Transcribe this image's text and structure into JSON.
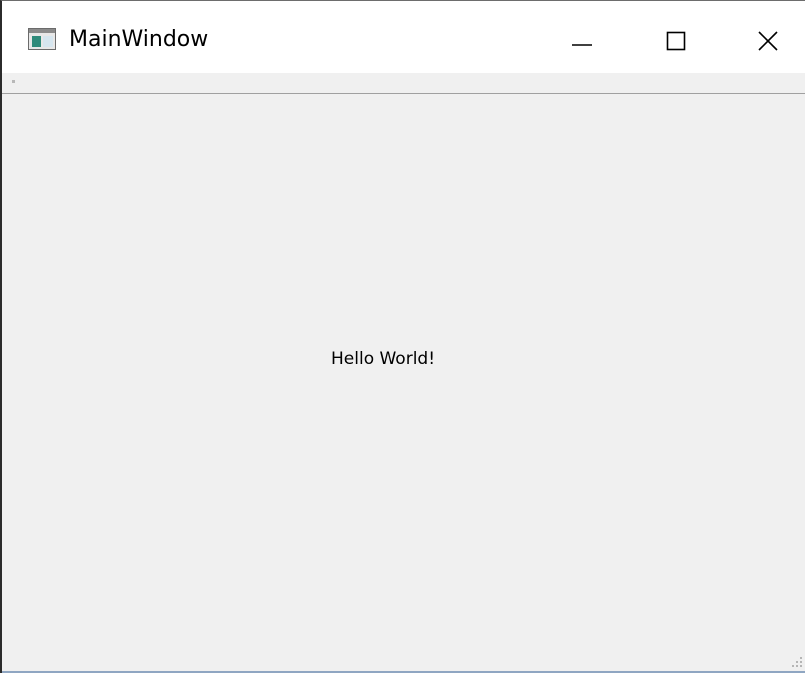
{
  "window": {
    "title": "MainWindow",
    "icon": "app-window-icon"
  },
  "controls": {
    "minimize_icon": "minimize-icon",
    "maximize_icon": "maximize-icon",
    "close_icon": "close-icon"
  },
  "content": {
    "label": "Hello World!"
  },
  "colors": {
    "titlebar": "#ffffff",
    "client_area": "#f0f0f0",
    "border": "#2b2b2b",
    "text": "#000000"
  }
}
